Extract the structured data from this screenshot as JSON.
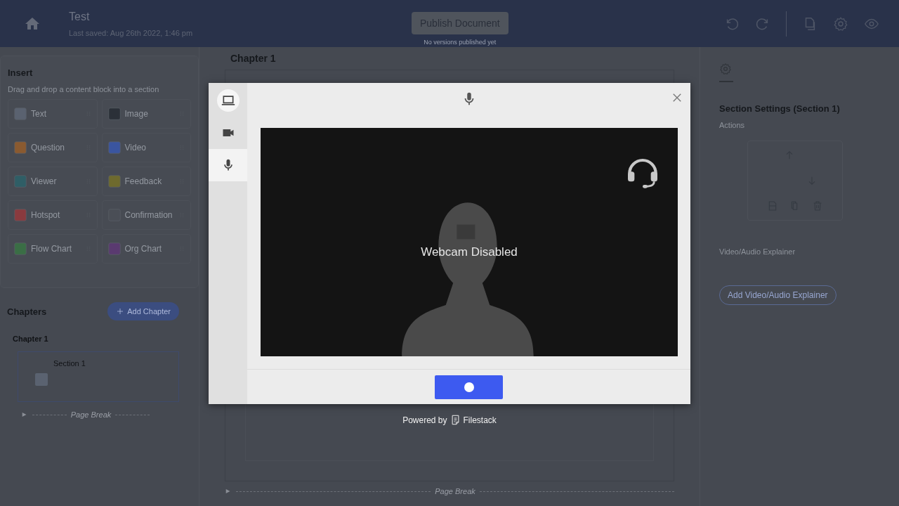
{
  "header": {
    "title": "Test",
    "last_saved": "Last saved: Aug 26th 2022, 1:46 pm",
    "publish_button": "Publish Document",
    "publish_note": "No versions published yet"
  },
  "insert": {
    "title": "Insert",
    "hint": "Drag and drop a content block into a section",
    "blocks": [
      {
        "label": "Text",
        "color": "#5a6270"
      },
      {
        "label": "Image",
        "color": "#2b3038"
      },
      {
        "label": "Question",
        "color": "#8a5a30"
      },
      {
        "label": "Video",
        "color": "#3a55a0"
      },
      {
        "label": "Viewer",
        "color": "#2f5e66"
      },
      {
        "label": "Feedback",
        "color": "#6e6a2e"
      },
      {
        "label": "Hotspot",
        "color": "#8a3a3e"
      },
      {
        "label": "Confirmation",
        "color": "#4a4e56"
      },
      {
        "label": "Flow Chart",
        "color": "#3a6e45"
      },
      {
        "label": "Org Chart",
        "color": "#5a3a70"
      }
    ]
  },
  "chapters": {
    "title": "Chapters",
    "add_button": "Add Chapter",
    "chapter": "Chapter 1",
    "section": "Section 1",
    "page_break": "Page Break"
  },
  "canvas": {
    "chapter_title": "Chapter 1",
    "page_break": "Page Break"
  },
  "settings": {
    "title": "Section Settings (Section 1)",
    "actions_label": "Actions",
    "explainer_title": "Video/Audio Explainer",
    "explainer_button": "Add Video/Audio Explainer"
  },
  "picker": {
    "tabs": [
      {
        "kind": "device",
        "selected": false
      },
      {
        "kind": "video",
        "selected": false
      },
      {
        "kind": "audio",
        "selected": true
      }
    ],
    "webcam_message": "Webcam Disabled",
    "powered_by": "Powered by",
    "brand": "Filestack"
  }
}
